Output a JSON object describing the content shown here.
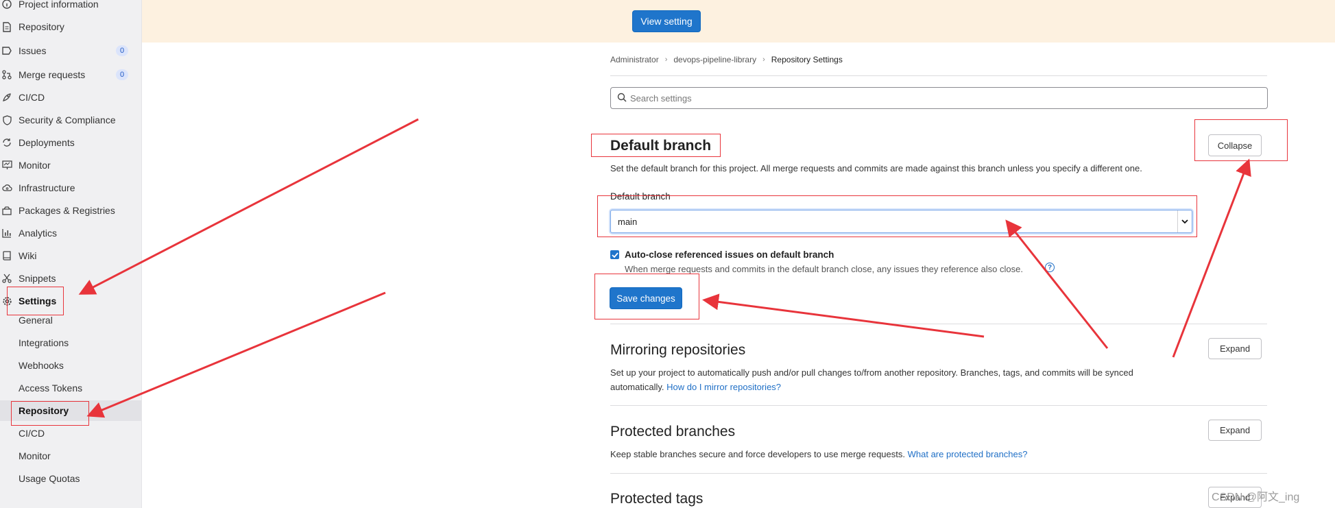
{
  "sidebar": {
    "items": [
      {
        "label": "Project information",
        "icon": "info-icon"
      },
      {
        "label": "Repository",
        "icon": "document-icon"
      },
      {
        "label": "Issues",
        "icon": "issues-icon",
        "count": "0"
      },
      {
        "label": "Merge requests",
        "icon": "merge-request-icon",
        "count": "0"
      },
      {
        "label": "CI/CD",
        "icon": "rocket-icon"
      },
      {
        "label": "Security & Compliance",
        "icon": "shield-icon"
      },
      {
        "label": "Deployments",
        "icon": "deployments-icon"
      },
      {
        "label": "Monitor",
        "icon": "monitor-icon"
      },
      {
        "label": "Infrastructure",
        "icon": "cloud-gear-icon"
      },
      {
        "label": "Packages & Registries",
        "icon": "package-icon"
      },
      {
        "label": "Analytics",
        "icon": "analytics-icon"
      },
      {
        "label": "Wiki",
        "icon": "book-icon"
      },
      {
        "label": "Snippets",
        "icon": "scissors-icon"
      },
      {
        "label": "Settings",
        "icon": "gear-icon"
      }
    ],
    "settings_sub": [
      "General",
      "Integrations",
      "Webhooks",
      "Access Tokens",
      "Repository",
      "CI/CD",
      "Monitor",
      "Usage Quotas"
    ]
  },
  "banner": {
    "button": "View setting"
  },
  "breadcrumb": [
    "Administrator",
    "devops-pipeline-library",
    "Repository Settings"
  ],
  "search": {
    "placeholder": "Search settings"
  },
  "default_branch": {
    "title": "Default branch",
    "collapse": "Collapse",
    "description": "Set the default branch for this project. All merge requests and commits are made against this branch unless you specify a different one.",
    "field_label": "Default branch",
    "selected": "main",
    "checkbox_label": "Auto-close referenced issues on default branch",
    "checkbox_checked": true,
    "checkbox_help": "When merge requests and commits in the default branch close, any issues they reference also close.",
    "save": "Save changes"
  },
  "mirroring": {
    "title": "Mirroring repositories",
    "expand": "Expand",
    "description": "Set up your project to automatically push and/or pull changes to/from another repository. Branches, tags, and commits will be synced",
    "description2": "automatically.",
    "link": "How do I mirror repositories?"
  },
  "protected_branches": {
    "title": "Protected branches",
    "expand": "Expand",
    "description": "Keep stable branches secure and force developers to use merge requests.",
    "link": "What are protected branches?"
  },
  "protected_tags": {
    "title": "Protected tags",
    "expand": "Expand"
  },
  "watermark": "CSDN @阿文_ing",
  "colors": {
    "primary": "#1f75cb",
    "annotation": "#e8343b",
    "banner": "#fdf1e0"
  }
}
